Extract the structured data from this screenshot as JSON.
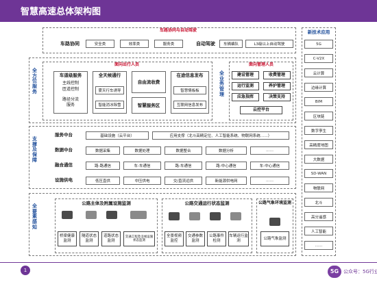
{
  "title": "智慧高速总体架构图",
  "top_section": {
    "title": "车路协同与自动驾驶",
    "left_label": "车路协同",
    "left_items": [
      "安全类",
      "效率类",
      "服务类"
    ],
    "right_label": "自动驾驶",
    "right_items": [
      "车辆编队",
      "L3级以上自动驾驶"
    ]
  },
  "service_section": {
    "side_label": "全方位服务",
    "travelers_title": "面向出行人员",
    "managers_title": "面向管理人员",
    "road_service": {
      "title": "车道级服务",
      "items": [
        "主线控制",
        "匝道控制",
        "路径分流",
        "服务"
      ]
    },
    "all_weather": {
      "title": "全天候通行",
      "items": [
        "雾天行车诱导",
        "智能消冰除雪"
      ]
    },
    "free_flow": "自由流收费",
    "smart_service": "智慧服务区",
    "info_release": {
      "title": "在途信息发布",
      "items": [
        "智慧情板板",
        "互联网信息发布"
      ]
    },
    "business_label": "全业务管理",
    "manage_items": [
      "建设管理",
      "收费管理",
      "运行监测",
      "养护管理",
      "应急指挥",
      "决策支持",
      "云控平台"
    ]
  },
  "support_section": {
    "side_label": "支撑及保障",
    "rows": [
      {
        "label": "服务中台",
        "items": [
          "基础设施（云平台）",
          "应用支撑（北斗高精定位、人工智能系统、物联网系统……）"
        ]
      },
      {
        "label": "数据中台",
        "items": [
          "数据采集",
          "数据处理",
          "数据整合",
          "数据分析",
          "……"
        ]
      },
      {
        "label": "融合通信",
        "items": [
          "路-路通信",
          "车-车通信",
          "路-车通信",
          "路-中心通信",
          "车-中心通信"
        ]
      },
      {
        "label": "设施供电",
        "items": [
          "低压直供",
          "中压供电",
          "交/直流远供",
          "新能源供电网",
          "……"
        ]
      }
    ]
  },
  "sensing_section": {
    "side_label": "全要素感知",
    "group1": {
      "title": "公路主体及附属设施监测",
      "items": [
        "桥梁健康监测",
        "隧道状态监测",
        "道路状态监测",
        "交通工程及沿线设施状态监测"
      ]
    },
    "group2": {
      "title": "公路交通运行状态监测",
      "items": [
        "全景视频监控",
        "交通参数监测",
        "公路事件检测",
        "车辆运行监测"
      ]
    },
    "group3": {
      "title": "公路气象环境监测",
      "items": [
        "公路气象监测"
      ]
    }
  },
  "tech_panel": {
    "title": "新技术应用",
    "items": [
      "5G",
      "C-V2X",
      "云计算",
      "边缘计算",
      "BIM",
      "区块链",
      "数字孪生",
      "高精度地图",
      "大数据",
      "SD-WAN",
      "物联网",
      "北斗",
      "高分遥感",
      "人工智能",
      "……"
    ]
  },
  "footer": {
    "page_number": "1",
    "logo_text": "5G",
    "account": "公众号：5G行业应用"
  }
}
